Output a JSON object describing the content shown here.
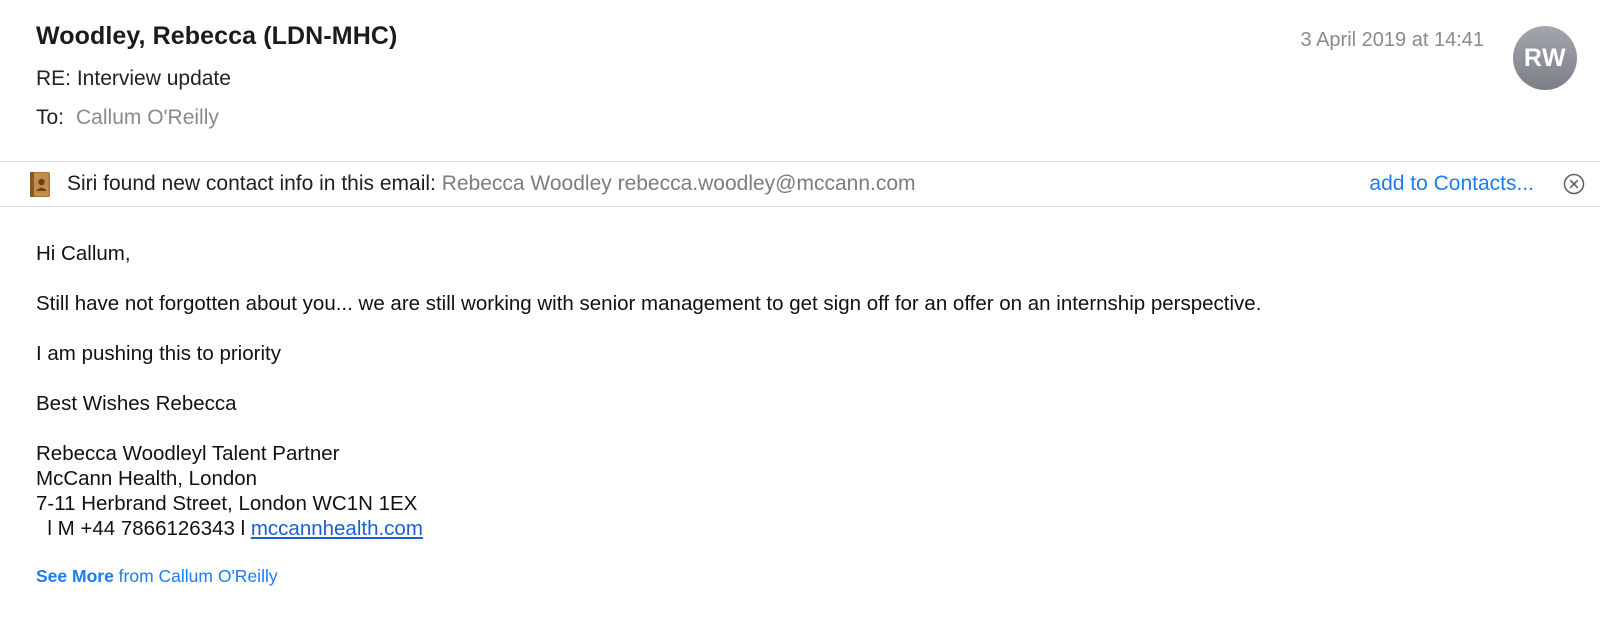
{
  "header": {
    "sender": "Woodley, Rebecca (LDN-MHC)",
    "subject": "RE: Interview update",
    "to_label": "To:",
    "to_value": "Callum O'Reilly",
    "date": "3 April 2019 at 14:41",
    "avatar_initials": "RW"
  },
  "siri_banner": {
    "label": "Siri found new contact info in this email:",
    "contact": "Rebecca Woodley rebecca.woodley@mccann.com",
    "action": "add to Contacts...",
    "icon": "contacts-book-icon",
    "close_icon": "close-circle-icon"
  },
  "body": {
    "greeting": "Hi Callum,",
    "paragraph1": "Still have not forgotten about you... we are still working with senior management to get sign off for an offer on an internship perspective.",
    "paragraph2": "I am pushing this to priority",
    "signoff": "Best Wishes Rebecca",
    "signature": {
      "line1": "Rebecca Woodleyl Talent Partner",
      "line2": "McCann Health, London",
      "line3": "7-11 Herbrand Street, London WC1N 1EX",
      "line4_prefix": "  l M +44 7866126343 l ",
      "website": "mccannhealth.com"
    }
  },
  "footer": {
    "see_more_bold": "See More",
    "see_more_rest": " from Callum O'Reilly"
  },
  "colors": {
    "link_blue": "#1c7cf0",
    "muted_gray": "#8a8a8a",
    "avatar_gray": "#8e9198"
  }
}
